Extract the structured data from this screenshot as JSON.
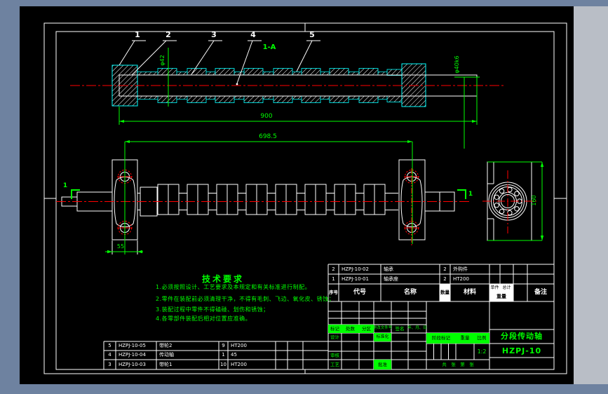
{
  "window": {
    "canvas_bg": "#000000",
    "chrome_blue": "#6e82a0",
    "chrome_gray": "#b9bec6"
  },
  "colors": {
    "line": "#ffffff",
    "dimension_green": "#00ff00",
    "hatch_edge_cyan": "#00ffff",
    "centerline_red": "#ff0000"
  },
  "labels": {
    "callouts": [
      "1",
      "2",
      "3",
      "4",
      "5"
    ],
    "section_view": "1-A",
    "cut_marker": "1"
  },
  "dims": {
    "total_length": "900",
    "bearing_span": "698.5",
    "base_width": "55",
    "housing_height": "160",
    "bore": "φ42",
    "journal": "φ40k6"
  },
  "tech": {
    "title": "技术要求",
    "lines": [
      "1.必须按照设计、工艺要求及本规定和有关标准进行制配。",
      "2.零件在装配前必须清理干净，不得有毛刺、飞边、氧化皮、锈蚀；",
      "3.装配过程中零件不得磕碰、划伤和锈蚀；",
      "4.各零部件装配后相对位置应准确。"
    ]
  },
  "parts": {
    "headers": {
      "seq": "序号",
      "code": "代号",
      "name": "名称",
      "qty": "数量",
      "material": "材料",
      "unit": "单件",
      "total": "总计",
      "weight": "重量",
      "remark": "备注"
    },
    "upper_rows": [
      {
        "seq": "2",
        "code": "HZPJ-10-02",
        "name": "轴承",
        "qty": "2",
        "material": "外购件"
      },
      {
        "seq": "1",
        "code": "HZPJ-10-01",
        "name": "轴承座",
        "qty": "2",
        "material": "HT200"
      }
    ],
    "lower_rows": [
      {
        "seq": "5",
        "code": "HZPJ-10-05",
        "name": "带轮2",
        "qty": "9",
        "material": "HT200"
      },
      {
        "seq": "4",
        "code": "HZPJ-10-04",
        "name": "传动轴",
        "qty": "1",
        "material": "45"
      },
      {
        "seq": "3",
        "code": "HZPJ-10-03",
        "name": "带轮1",
        "qty": "10",
        "material": "HT200"
      }
    ]
  },
  "tb": {
    "rev": [
      "标记",
      "处数",
      "分区",
      "更改文件号",
      "签名",
      "年、月、日"
    ],
    "design": "设计",
    "standardization": "标准化",
    "review": "审核",
    "process": "工艺",
    "approve": "批准",
    "stage_mark": "阶段标记",
    "weight": "重量",
    "scale_label": "比例",
    "scale_value": "1:2",
    "sheet": "共　张　第　张",
    "part_name": "分段传动轴",
    "drawing_no": "HZPJ-10"
  }
}
